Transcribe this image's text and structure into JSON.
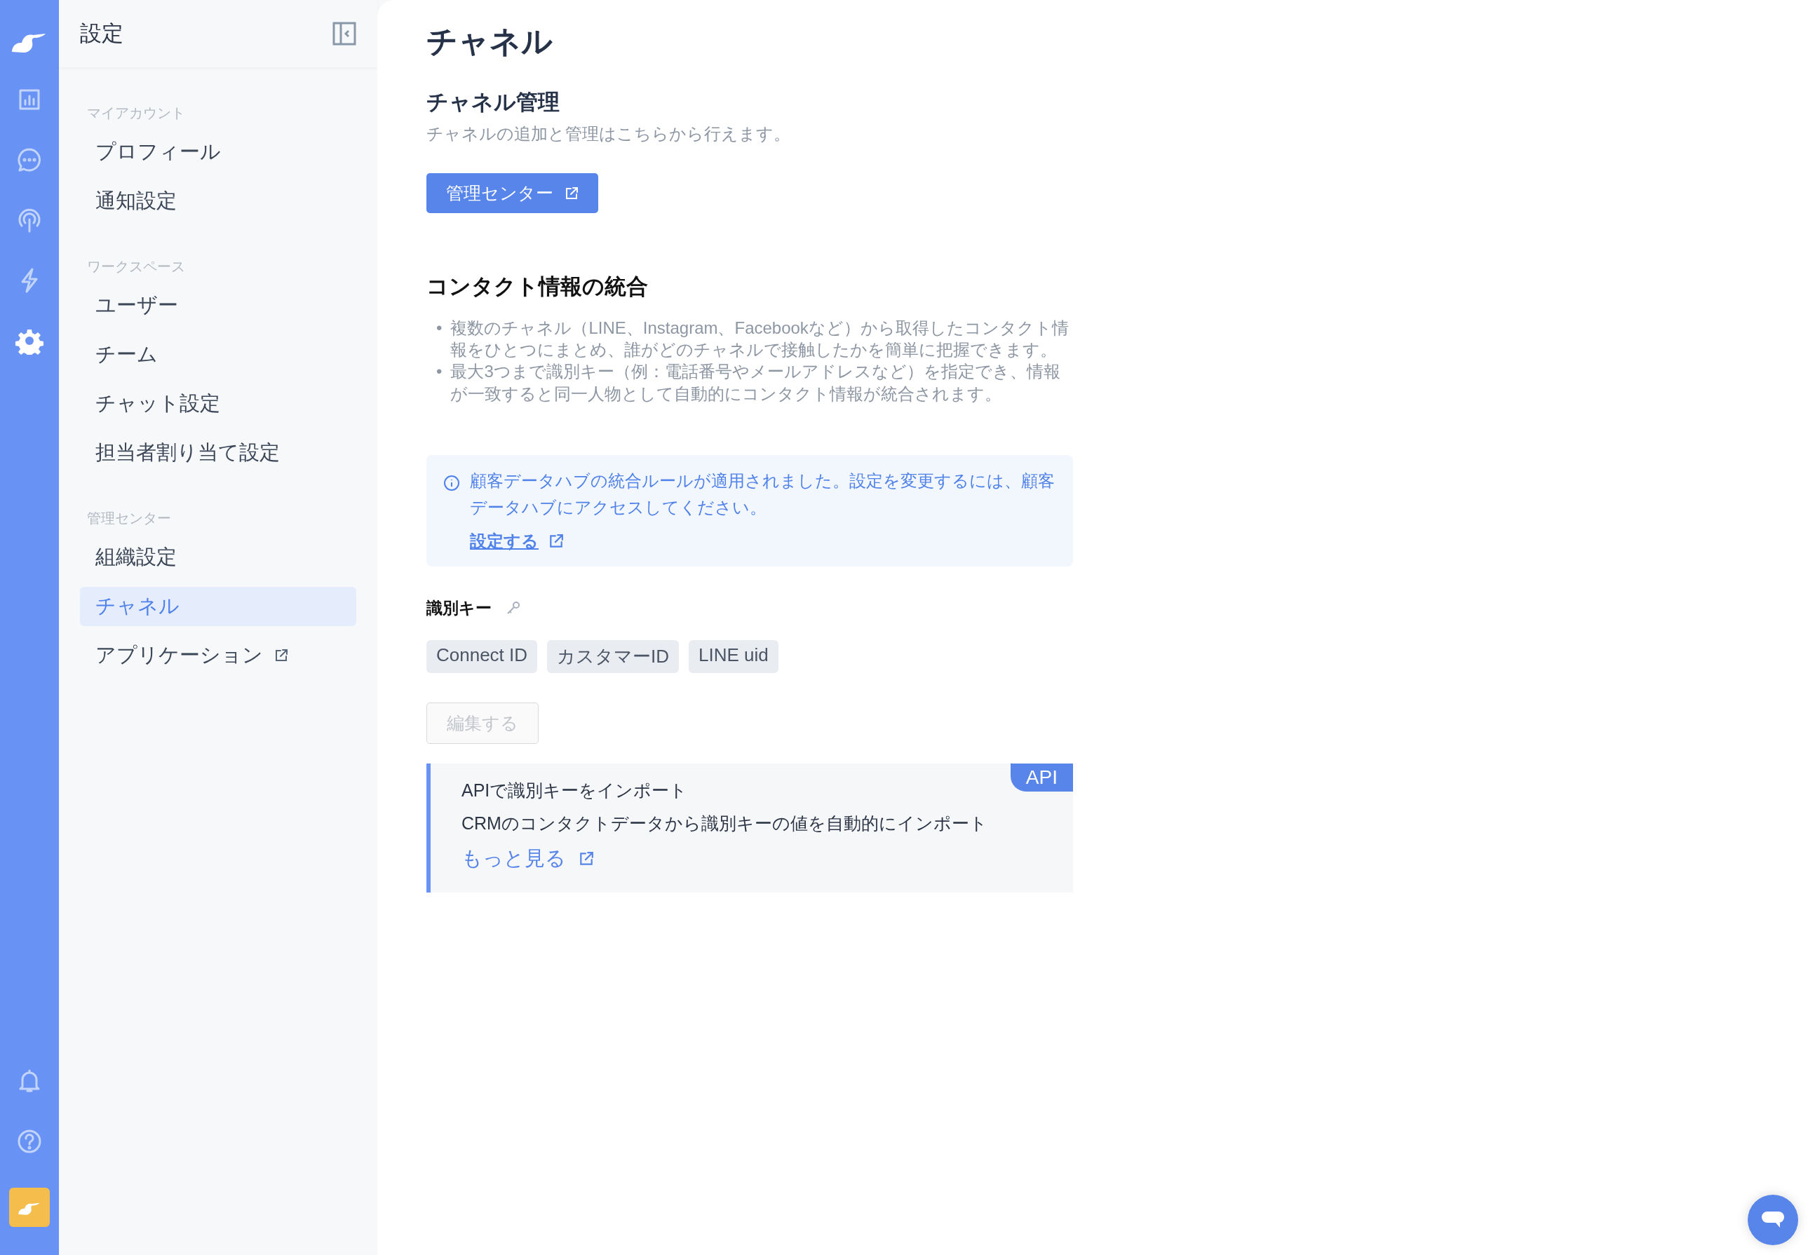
{
  "rail": {
    "top": [
      {
        "kind": "chart",
        "selected": false
      },
      {
        "kind": "chat",
        "selected": false
      },
      {
        "kind": "broadcast",
        "selected": false
      },
      {
        "kind": "bolt",
        "selected": false
      },
      {
        "kind": "gear",
        "selected": true
      }
    ],
    "bottom": [
      {
        "kind": "bell",
        "selected": false
      },
      {
        "kind": "help",
        "selected": false
      }
    ]
  },
  "sidebar": {
    "title": "設定",
    "sections": [
      {
        "label": "マイアカウント",
        "items": [
          {
            "label": "プロフィール",
            "selected": false,
            "external": false
          },
          {
            "label": "通知設定",
            "selected": false,
            "external": false
          }
        ]
      },
      {
        "label": "ワークスペース",
        "items": [
          {
            "label": "ユーザー",
            "selected": false,
            "external": false
          },
          {
            "label": "チーム",
            "selected": false,
            "external": false
          },
          {
            "label": "チャット設定",
            "selected": false,
            "external": false
          },
          {
            "label": "担当者割り当て設定",
            "selected": false,
            "external": false
          }
        ]
      },
      {
        "label": "管理センター",
        "items": [
          {
            "label": "組織設定",
            "selected": false,
            "external": false
          },
          {
            "label": "チャネル",
            "selected": true,
            "external": false
          },
          {
            "label": "アプリケーション",
            "selected": false,
            "external": true
          }
        ]
      }
    ]
  },
  "main": {
    "title": "チャネル",
    "channel_management": {
      "heading": "チャネル管理",
      "description": "チャネルの追加と管理はこちらから行えます。",
      "button": "管理センター"
    },
    "contact_merge": {
      "heading": "コンタクト情報の統合",
      "bullets": [
        {
          "marker": "•",
          "text": "複数のチャネル（LINE、Instagram、Facebookなど）から取得したコンタクト情報をひとつにまとめ、誰がどのチャネルで接触したかを簡単に把握できます。"
        },
        {
          "marker": "•",
          "text": "最大3つまで識別キー（例：電話番号やメールアドレスなど）を指定でき、情報が一致すると同一人物として自動的にコンタクト情報が統合されます。"
        }
      ]
    },
    "notice": {
      "text": "顧客データハブの統合ルールが適用されました。設定を変更するには、顧客データハブにアクセスしてください。",
      "link": "設定する"
    },
    "identification_keys": {
      "label": "識別キー",
      "keys": [
        "Connect ID",
        "カスタマーID",
        "LINE uid"
      ],
      "edit_button": "編集する",
      "edit_disabled": true
    },
    "api_card": {
      "badge": "API",
      "title": "APIで識別キーをインポート",
      "description": "CRMのコンタクトデータから識別キーの値を自動的にインポート",
      "link": "もっと見る"
    }
  }
}
